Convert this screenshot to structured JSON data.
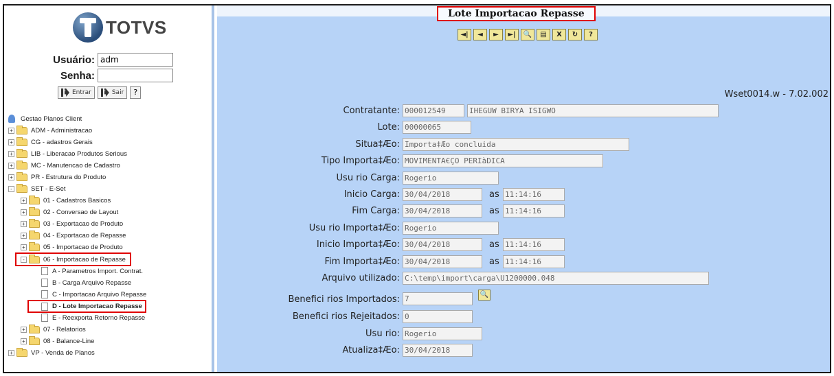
{
  "login": {
    "logo_text": "TOTVS",
    "usuario_label": "Usuário:",
    "usuario_value": "adm",
    "senha_label": "Senha:",
    "senha_value": "",
    "entrar_label": "Entrar",
    "sair_label": "Sair",
    "help_label": "?"
  },
  "tree": {
    "root": "Gestao Planos Client",
    "items": [
      {
        "pm": "+",
        "label": "ADM - Administracao"
      },
      {
        "pm": "+",
        "label": "CG - adastros Gerais"
      },
      {
        "pm": "+",
        "label": "LIB - Liberacao Produtos Serious"
      },
      {
        "pm": "+",
        "label": "MC - Manutencao de Cadastro"
      },
      {
        "pm": "+",
        "label": "PR - Estrutura do Produto"
      },
      {
        "pm": "-",
        "label": "SET - E-Set"
      }
    ],
    "set_children": [
      {
        "pm": "+",
        "label": "01 - Cadastros Basicos"
      },
      {
        "pm": "+",
        "label": "02 - Conversao de Layout"
      },
      {
        "pm": "+",
        "label": "03 - Exportacao de Produto"
      },
      {
        "pm": "+",
        "label": "04 - Exportacao de Repasse"
      },
      {
        "pm": "+",
        "label": "05 - Importacao de Produto"
      },
      {
        "pm": "-",
        "label": "06 - Importacao de Repasse"
      }
    ],
    "repasse_children": [
      {
        "label": "A - Parametros Import. Contrat."
      },
      {
        "label": "B - Carga Arquivo Repasse"
      },
      {
        "label": "C - Importacao Arquivo Repasse"
      },
      {
        "label": "D - Lote Importacao Repasse"
      },
      {
        "label": "E - Reexporta Retorno Repasse"
      }
    ],
    "after": [
      {
        "pm": "+",
        "label": "07 - Relatorios"
      },
      {
        "pm": "+",
        "label": "08 - Balance-Line"
      },
      {
        "pm": "+",
        "label": "VP - Venda de Planos"
      }
    ]
  },
  "header": {
    "title": "Lote Importacao Repasse",
    "version": "Wset0014.w - 7.02.002"
  },
  "toolbar": {
    "buttons": [
      "first-icon",
      "prev-icon",
      "next-icon",
      "last-icon",
      "search-icon",
      "list-icon",
      "close-icon",
      "refresh-icon",
      "help-icon"
    ],
    "glyphs": [
      "◄|",
      "◄",
      "►",
      "►|",
      "🔍",
      "▤",
      "X",
      "↻",
      "?"
    ]
  },
  "form": {
    "contratante_label": "Contratante:",
    "contratante_code": "000012549",
    "contratante_name": "IHEGUW BIRYA ISIGWO",
    "lote_label": "Lote:",
    "lote_value": "00000065",
    "situacao_label": "Situa‡Æo:",
    "situacao_value": "Importa‡Æo concluida",
    "tipo_label": "Tipo Importa‡Æo:",
    "tipo_value": "MOVIMENTA€ÇO PERIàDICA",
    "usu_carga_label": "Usu rio Carga:",
    "usu_carga_value": "Rogerio",
    "inicio_carga_label": "Inicio Carga:",
    "inicio_carga_date": "30/04/2018",
    "inicio_carga_time": "11:14:16",
    "fim_carga_label": "Fim Carga:",
    "fim_carga_date": "30/04/2018",
    "fim_carga_time": "11:14:16",
    "usu_importacao_label": "Usu rio Importa‡Æo:",
    "usu_importacao_value": "Rogerio",
    "inicio_importacao_label": "Inicio Importa‡Æo:",
    "inicio_importacao_date": "30/04/2018",
    "inicio_importacao_time": "11:14:16",
    "fim_importacao_label": "Fim Importa‡Æo:",
    "fim_importacao_date": "30/04/2018",
    "fim_importacao_time": "11:14:16",
    "as_label": "as",
    "arquivo_label": "Arquivo utilizado:",
    "arquivo_value": "C:\\temp\\import\\carga\\U1200000.048",
    "benef_importados_label": "Benefici rios Importados:",
    "benef_importados_value": "7",
    "benef_rejeitados_label": "Benefici rios Rejeitados:",
    "benef_rejeitados_value": "0",
    "usuario_label": "Usu rio:",
    "usuario_value": "Rogerio",
    "atualizacao_label": "Atualiza‡Æo:",
    "atualizacao_value": "30/04/2018"
  },
  "colors": {
    "panel_bg": "#b7d3f7",
    "highlight": "#e00000",
    "toolbar_button": "#f0e79a"
  }
}
